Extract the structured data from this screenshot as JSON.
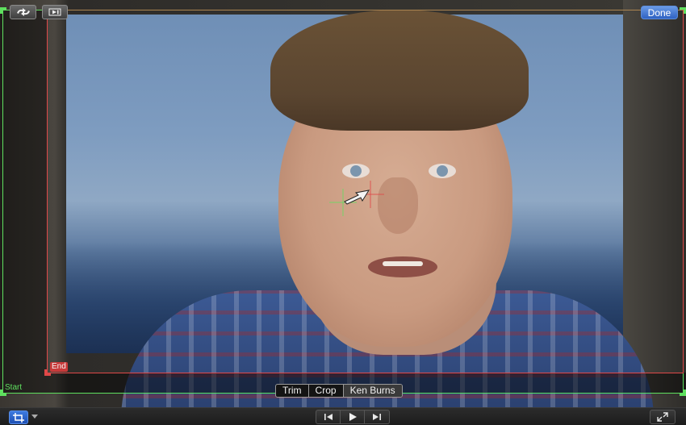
{
  "topbar": {
    "swap_icon": "swap-arrows-icon",
    "preview_icon": "play-preview-icon",
    "done_label": "Done"
  },
  "frames": {
    "start_label": "Start",
    "end_label": "End",
    "start_color": "#5fe05f",
    "end_color": "#e04848"
  },
  "crop_modes": [
    {
      "label": "Trim",
      "active": false
    },
    {
      "label": "Crop",
      "active": false
    },
    {
      "label": "Ken Burns",
      "active": true
    }
  ],
  "bottombar": {
    "crop_tool_icon": "crop-icon",
    "crop_menu_icon": "chevron-down-icon",
    "transport": [
      "skip-back-icon",
      "play-icon",
      "skip-forward-icon"
    ],
    "fullscreen_icon": "fullscreen-icon"
  },
  "colors": {
    "accent": "#2f62c2",
    "start_frame": "#5fe05f",
    "end_frame": "#e04848"
  }
}
